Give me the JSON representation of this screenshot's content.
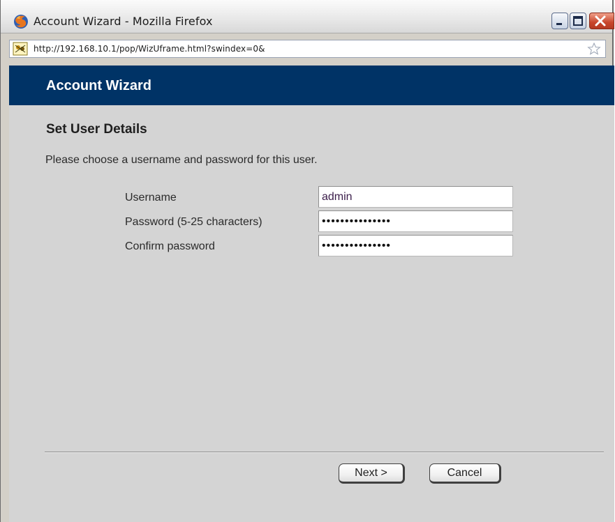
{
  "window": {
    "title": "Account Wizard - Mozilla Firefox",
    "controls": [
      "minimize-icon",
      "maximize-icon",
      "close-icon"
    ]
  },
  "addressbar": {
    "url": "http://192.168.10.1/pop/WizUframe.html?swindex=0&",
    "site_icon": "site-identity-icon",
    "bookmark_icon": "star-icon"
  },
  "page": {
    "header_title": "Account Wizard",
    "section_title": "Set User Details",
    "instructions": "Please choose a username and password for this user.",
    "fields": [
      {
        "label": "Username",
        "value": "admin",
        "type": "text"
      },
      {
        "label": "Password (5-25 characters)",
        "value": "•••••••••••••••",
        "type": "password"
      },
      {
        "label": "Confirm password",
        "value": "•••••••••••••••",
        "type": "password"
      }
    ],
    "buttons": {
      "next": "Next >",
      "cancel": "Cancel"
    }
  },
  "colors": {
    "header_bg": "#003366",
    "page_bg": "#d4d4d4"
  }
}
